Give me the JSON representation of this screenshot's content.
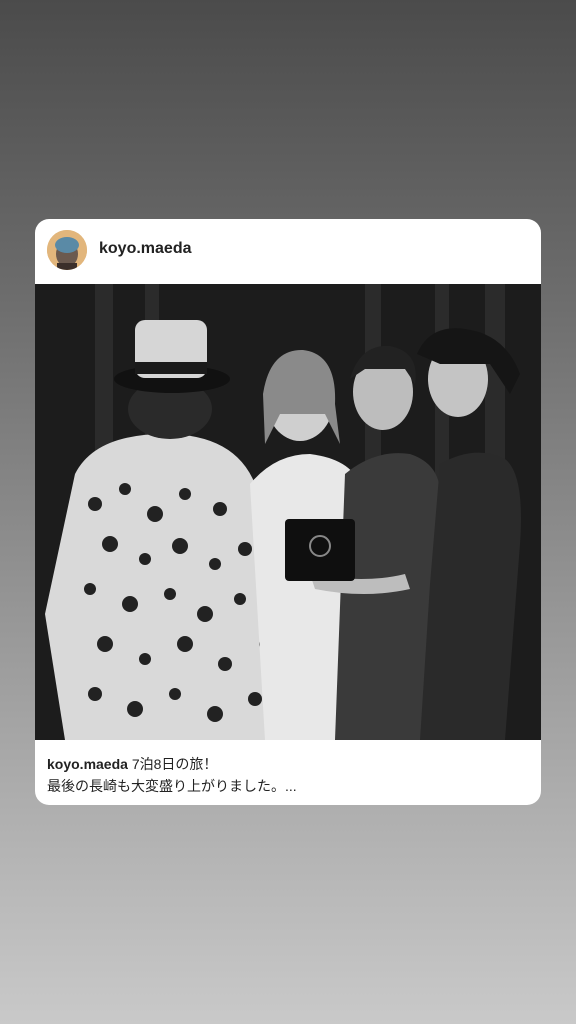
{
  "post": {
    "username": "koyo.maeda",
    "caption_user": "koyo.maeda",
    "caption_line1": "7泊8日の旅！",
    "caption_line2": "最後の長崎も大変盛り上がりました。..."
  },
  "icons": {
    "avatar": "profile-avatar",
    "photo": "concert-stage-photo"
  }
}
